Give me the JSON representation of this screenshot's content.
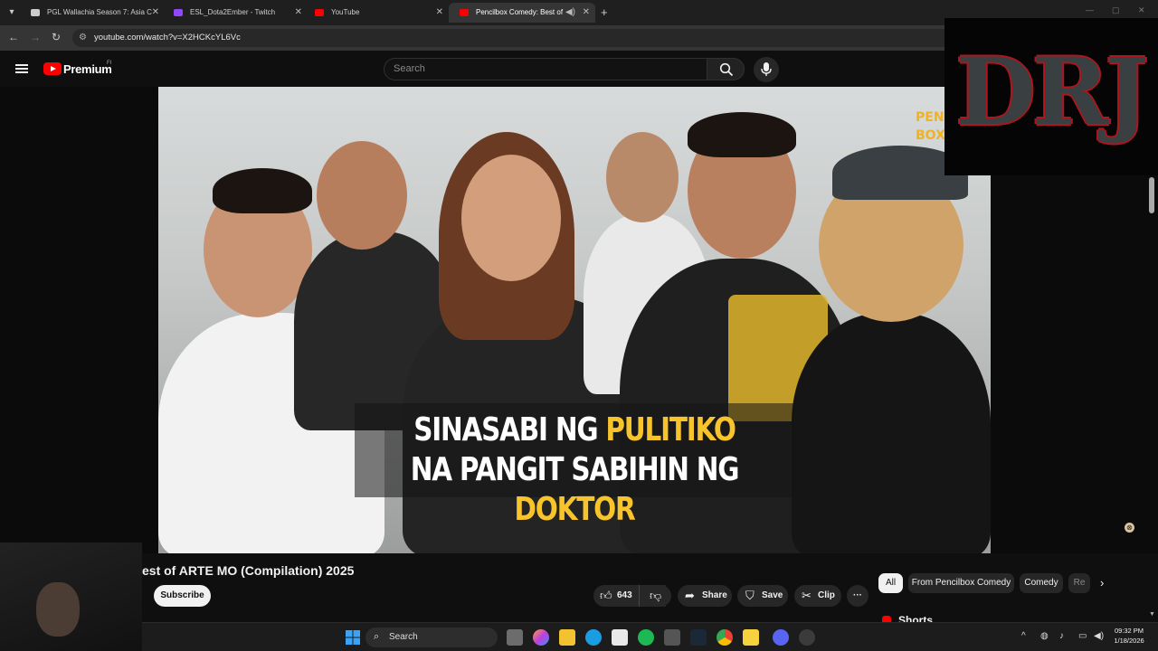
{
  "browser": {
    "tabs": [
      {
        "label": "PGL Wallachia Season 7: Asia C",
        "favicon_color": "#cccccc"
      },
      {
        "label": "ESL_Dota2Ember - Twitch",
        "favicon_color": "#9146ff"
      },
      {
        "label": "YouTube",
        "favicon_color": "#ff0000"
      },
      {
        "label": "Pencilbox Comedy: Best of",
        "favicon_color": "#ff0000"
      }
    ],
    "new_tab": "+",
    "window_controls": [
      "—",
      "▢",
      "✕"
    ],
    "url": "youtube.com/watch?v=X2HCKcYL6Vc"
  },
  "youtube": {
    "brand": "Premium",
    "country_code": "FI",
    "search_placeholder": "Search"
  },
  "video": {
    "caption_line1_white": "SINASABI NG ",
    "caption_line1_yellow": "PULITIKO",
    "caption_line2_white": "NA PANGIT SABIHIN NG ",
    "caption_line2_yellow": "DOKTOR",
    "watermark": "PEN BOX",
    "title": "est of ARTE MO (Compilation) 2025",
    "subscribe_label": "Subscribe",
    "like_count": "643",
    "share_label": "Share",
    "save_label": "Save",
    "clip_label": "Clip",
    "more_label": "···"
  },
  "overlay": {
    "logo_text": "DRJ"
  },
  "sidebar": {
    "chips": [
      "All",
      "From Pencilbox Comedy",
      "Comedy",
      "Re"
    ],
    "shorts_label": "Shorts"
  },
  "taskbar": {
    "search_label": "Search",
    "time": "09:32 PM",
    "date": "1/18/2026"
  },
  "colors": {
    "accent_red": "#ff0000",
    "caption_yellow": "#f7c52b",
    "logo_red": "#b0151d"
  }
}
